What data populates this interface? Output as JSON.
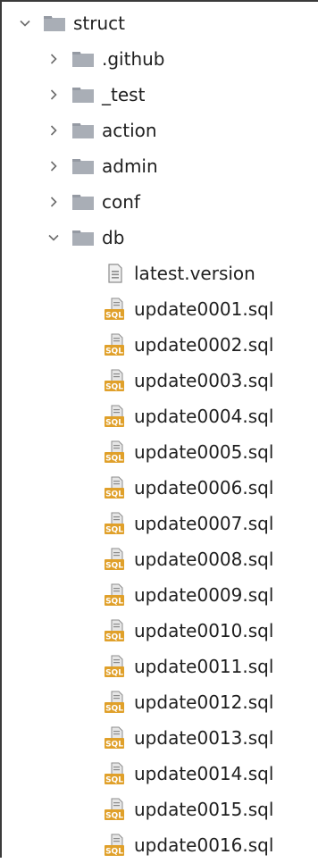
{
  "tree": {
    "root": {
      "name": "struct",
      "expanded": true,
      "icon": "folder-icon"
    },
    "folders": [
      {
        "name": ".github",
        "expanded": false,
        "icon": "folder-icon"
      },
      {
        "name": "_test",
        "expanded": false,
        "icon": "folder-icon"
      },
      {
        "name": "action",
        "expanded": false,
        "icon": "folder-icon"
      },
      {
        "name": "admin",
        "expanded": false,
        "icon": "folder-icon"
      },
      {
        "name": "conf",
        "expanded": false,
        "icon": "folder-icon"
      },
      {
        "name": "db",
        "expanded": true,
        "icon": "folder-icon"
      }
    ],
    "db_files": [
      {
        "name": "latest.version",
        "icon": "text-file-icon"
      },
      {
        "name": "update0001.sql",
        "icon": "sql-file-icon"
      },
      {
        "name": "update0002.sql",
        "icon": "sql-file-icon"
      },
      {
        "name": "update0003.sql",
        "icon": "sql-file-icon"
      },
      {
        "name": "update0004.sql",
        "icon": "sql-file-icon"
      },
      {
        "name": "update0005.sql",
        "icon": "sql-file-icon"
      },
      {
        "name": "update0006.sql",
        "icon": "sql-file-icon"
      },
      {
        "name": "update0007.sql",
        "icon": "sql-file-icon"
      },
      {
        "name": "update0008.sql",
        "icon": "sql-file-icon"
      },
      {
        "name": "update0009.sql",
        "icon": "sql-file-icon"
      },
      {
        "name": "update0010.sql",
        "icon": "sql-file-icon"
      },
      {
        "name": "update0011.sql",
        "icon": "sql-file-icon"
      },
      {
        "name": "update0012.sql",
        "icon": "sql-file-icon"
      },
      {
        "name": "update0013.sql",
        "icon": "sql-file-icon"
      },
      {
        "name": "update0014.sql",
        "icon": "sql-file-icon"
      },
      {
        "name": "update0015.sql",
        "icon": "sql-file-icon"
      },
      {
        "name": "update0016.sql",
        "icon": "sql-file-icon"
      }
    ]
  },
  "colors": {
    "folder": "#a9aeb6",
    "folder_tab": "#959aa3",
    "sql_badge": "#e0a02a",
    "sql_text": "#ffffff",
    "text": "#1f1f1f",
    "chevron": "#6b6b6b",
    "text_file": "#8c8c8c"
  }
}
